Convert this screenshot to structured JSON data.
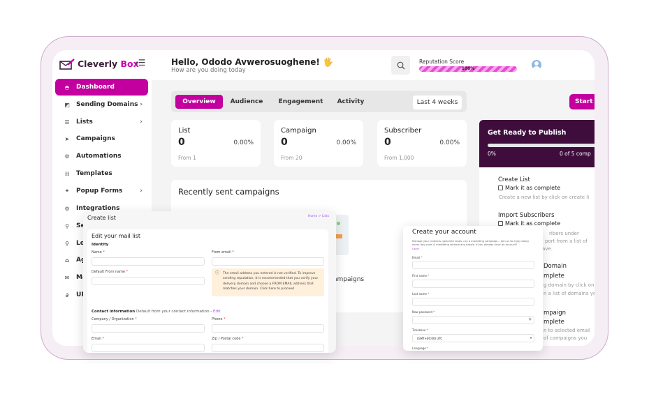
{
  "brand": {
    "name_part1": "Cleverly",
    "name_part2": "Box",
    "color": "#c800b4"
  },
  "header": {
    "greeting": "Hello, Ododo Avwerosuoghene!",
    "wave": "🖐",
    "subtitle": "How are you doing today",
    "reputation_label": "Reputation Score",
    "reputation_value": "100%",
    "reputation_percent": 100
  },
  "sidebar": {
    "items": [
      {
        "label": "Dashboard",
        "icon": "gauge-icon",
        "active": true
      },
      {
        "label": "Sending Domains",
        "icon": "domain-icon",
        "chevron": true
      },
      {
        "label": "Lists",
        "icon": "list-icon",
        "chevron": true
      },
      {
        "label": "Campaigns",
        "icon": "paper-plane-icon"
      },
      {
        "label": "Automations",
        "icon": "gear-icon"
      },
      {
        "label": "Templates",
        "icon": "grid-icon"
      },
      {
        "label": "Popup Forms",
        "icon": "popup-icon",
        "chevron": true
      },
      {
        "label": "Integrations",
        "icon": "gear-icon"
      },
      {
        "label": "Sec",
        "icon": "search-icon"
      },
      {
        "label": "Log",
        "icon": "search-icon"
      },
      {
        "label": "Ag",
        "icon": "agency-icon"
      },
      {
        "label": "Ma",
        "icon": "mail-icon"
      },
      {
        "label": "URL",
        "icon": "link-icon"
      }
    ]
  },
  "tabs": {
    "items": [
      "Overview",
      "Audience",
      "Engagement",
      "Activity"
    ],
    "active": "Overview",
    "range": "Last 4 weeks"
  },
  "start_button": "Start h",
  "stats": [
    {
      "label": "List",
      "value": "0",
      "percent": "0.00%",
      "from": "From 1"
    },
    {
      "label": "Campaign",
      "value": "0",
      "percent": "0.00%",
      "from": "From 20"
    },
    {
      "label": "Subscriber",
      "value": "0",
      "percent": "0.00%",
      "from": "From 1,000"
    }
  ],
  "recent": {
    "title": "Recently sent campaigns",
    "empty_fragment": "ampaigns"
  },
  "publish": {
    "title": "Get Ready to Publish",
    "progress_label": "0%",
    "progress_percent": 0,
    "count_fragment": "0 of 5 comp",
    "steps": [
      {
        "title": "Create List",
        "check": "Mark it as complete",
        "desc": "Create a new list by click on create li"
      },
      {
        "title": "Import Subscribers",
        "check": "Mark it as complete",
        "desc1": "ribers under",
        "desc2": "port from a list of",
        "desc3": "ave."
      },
      {
        "title": "Domain",
        "check": "mplete",
        "desc1": "g domain by click on",
        "desc2": "n a list of domains yo"
      },
      {
        "title": "mpaign",
        "check": "mplete",
        "desc1": "n to selected email",
        "desc2": "of campaigns you"
      }
    ]
  },
  "create_list": {
    "title": "Create list",
    "breadcrumb": "Home > Lists",
    "card_title": "Edit your mail list",
    "identity": "Identity",
    "name_label": "Name",
    "from_email_label": "From email",
    "default_from_label": "Default From name",
    "warning": "The email address you entered is not verified. To improve sending reputation, it is recommended that you verify your delivery domain and choose a FROM EMAIL address that matches your domain. Click here to proceed",
    "contact_title": "Contact information",
    "contact_sub": "Default from your contact information -",
    "contact_edit": "Edit",
    "company_label": "Company / Organization",
    "phone_label": "Phone",
    "email_label": "Email",
    "zip_label": "Zip / Postal code"
  },
  "create_account": {
    "title": "Create your account",
    "intro": "Manage your contacts, generate leads, run a marketing campaign... Join us to enjoy doing every day sales & marketing without any hassle. If you already have an account?",
    "login": "Login",
    "email_label": "Email",
    "first_label": "First name",
    "last_label": "Last name",
    "password_label": "New password",
    "timezone_label": "Timezone",
    "timezone_value": "(GMT+00:00) UTC",
    "language_label": "Language"
  }
}
